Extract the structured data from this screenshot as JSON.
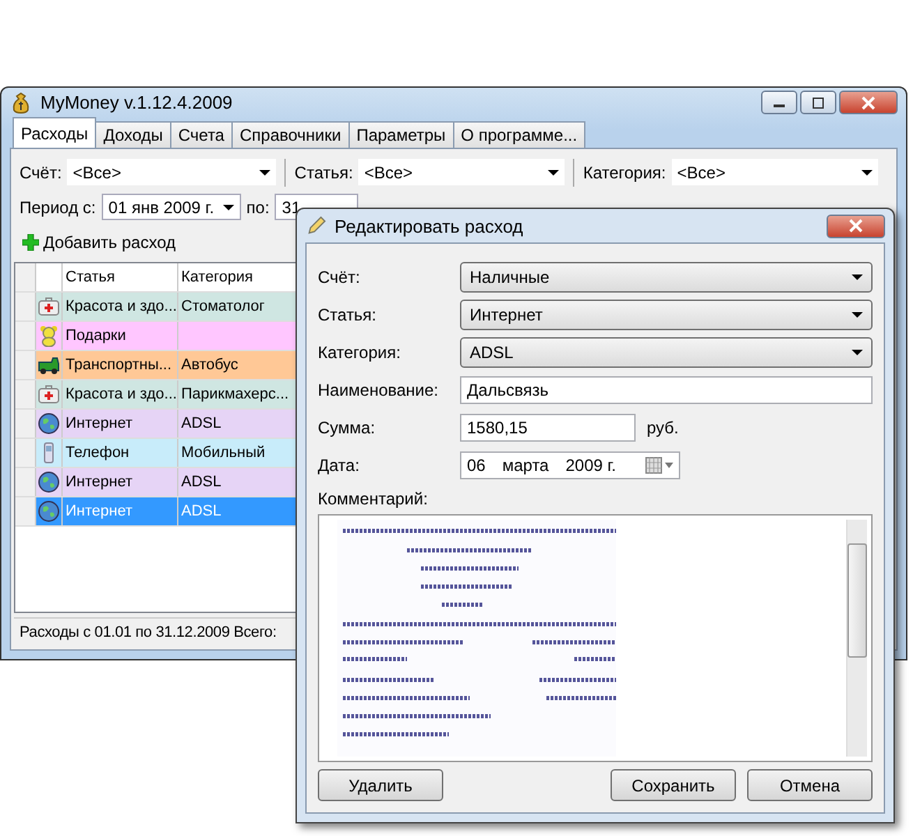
{
  "window": {
    "title": "MyMoney v.1.12.4.2009"
  },
  "tabs": [
    {
      "label": "Расходы",
      "selected": true
    },
    {
      "label": "Доходы",
      "selected": false
    },
    {
      "label": "Счета",
      "selected": false
    },
    {
      "label": "Справочники",
      "selected": false
    },
    {
      "label": "Параметры",
      "selected": false
    },
    {
      "label": "О программе...",
      "selected": false
    }
  ],
  "filters": {
    "account_label": "Счёт:",
    "account": "<Все>",
    "article_label": "Статья:",
    "article": "<Все>",
    "category_label": "Категория:",
    "category": "<Все>",
    "period_from_label": "Период с:",
    "period_from": "01 янв 2009 г.",
    "period_to_label": "по:",
    "period_to": "31"
  },
  "add_button": "Добавить расход",
  "table": {
    "columns": [
      "Статья",
      "Категория"
    ],
    "rows": [
      {
        "kind": "health",
        "color": "#cfe6e2",
        "article": "Красота и здо...",
        "category": "Стоматолог",
        "selected": false
      },
      {
        "kind": "gift",
        "color": "#ffc6ff",
        "article": "Подарки",
        "category": "",
        "selected": false
      },
      {
        "kind": "transport",
        "color": "#ffc896",
        "article": "Транспортны...",
        "category": "Автобус",
        "selected": false
      },
      {
        "kind": "health",
        "color": "#cfe6e2",
        "article": "Красота и здо...",
        "category": "Парикмахерс...",
        "selected": false
      },
      {
        "kind": "internet",
        "color": "#e6d4f6",
        "article": "Интернет",
        "category": "ADSL",
        "selected": false
      },
      {
        "kind": "phone",
        "color": "#c8ecfa",
        "article": "Телефон",
        "category": "Мобильный",
        "selected": false
      },
      {
        "kind": "internet",
        "color": "#e6d4f6",
        "article": "Интернет",
        "category": "ADSL",
        "selected": false
      },
      {
        "kind": "internet",
        "article": "Интернет",
        "category": "ADSL",
        "selected": true
      }
    ]
  },
  "status_bar": "Расходы с 01.01 по 31.12.2009  Всего:",
  "dialog": {
    "title": "Редактировать расход",
    "fields": [
      {
        "kind": "combo",
        "label": "Счёт:",
        "value": "Наличные"
      },
      {
        "kind": "combo",
        "label": "Статья:",
        "value": "Интернет"
      },
      {
        "kind": "combo",
        "label": "Категория:",
        "value": "ADSL"
      },
      {
        "kind": "text",
        "label": "Наименование:",
        "value": "Дальсвязь"
      },
      {
        "kind": "amount",
        "label": "Сумма:",
        "value": "1580,15",
        "unit": "руб."
      },
      {
        "kind": "date",
        "label": "Дата:",
        "day": "06",
        "month": "марта",
        "year": "2009 г."
      }
    ],
    "comment_label": "Комментарий:",
    "buttons": [
      "Удалить",
      "Сохранить",
      "Отмена"
    ]
  }
}
